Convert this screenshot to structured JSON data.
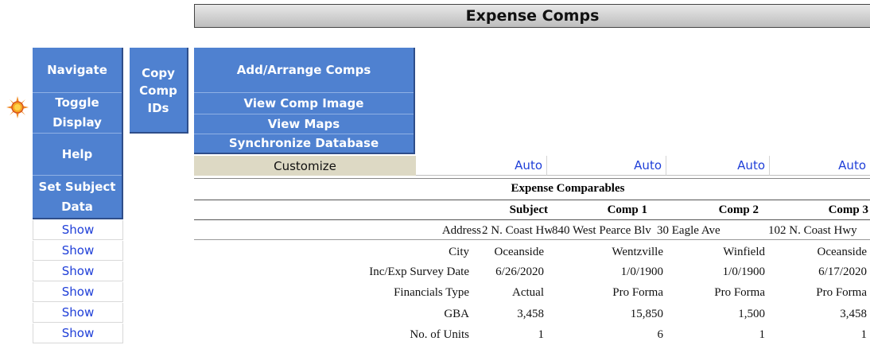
{
  "title": "Expense Comps",
  "nav": {
    "navigate": "Navigate",
    "toggle_display": [
      "Toggle",
      "Display"
    ],
    "help": "Help",
    "set_subject": [
      "Set Subject",
      "Data"
    ]
  },
  "copy_ids": [
    "Copy",
    "Comp",
    "IDs"
  ],
  "comps_menu": {
    "add_arrange": "Add/Arrange Comps",
    "view_image": "View Comp Image",
    "view_maps": "View Maps",
    "sync_db": "Synchronize Database"
  },
  "customize": "Customize",
  "auto_labels": [
    "Auto",
    "Auto",
    "Auto",
    "Auto"
  ],
  "section_title": "Expense Comparables",
  "columns": [
    "Subject",
    "Comp 1",
    "Comp 2",
    "Comp 3"
  ],
  "show_labels": [
    "Show",
    "Show",
    "Show",
    "Show",
    "Show",
    "Show"
  ],
  "rows": [
    {
      "label": "Address",
      "values": [
        "2 N. Coast Hw",
        "840 West Pearce Blv",
        "30 Eagle Ave",
        "102 N. Coast Hwy"
      ]
    },
    {
      "label": "City",
      "values": [
        "Oceanside",
        "Wentzville",
        "Winfield",
        "Oceanside"
      ]
    },
    {
      "label": "Inc/Exp Survey Date",
      "values": [
        "6/26/2020",
        "1/0/1900",
        "1/0/1900",
        "6/17/2020"
      ]
    },
    {
      "label": "Financials Type",
      "values": [
        "Actual",
        "Pro Forma",
        "Pro Forma",
        "Pro Forma"
      ]
    },
    {
      "label": "GBA",
      "values": [
        "3,458",
        "15,850",
        "1,500",
        "3,458"
      ]
    },
    {
      "label": "No. of Units",
      "values": [
        "1",
        "6",
        "1",
        "1"
      ]
    }
  ],
  "colors": {
    "button_blue": "#4f81d0",
    "link_blue": "#1f3fd8",
    "customize_bg": "#ddd9c4"
  },
  "icons": {
    "toggle_indicator": "sun-icon"
  }
}
